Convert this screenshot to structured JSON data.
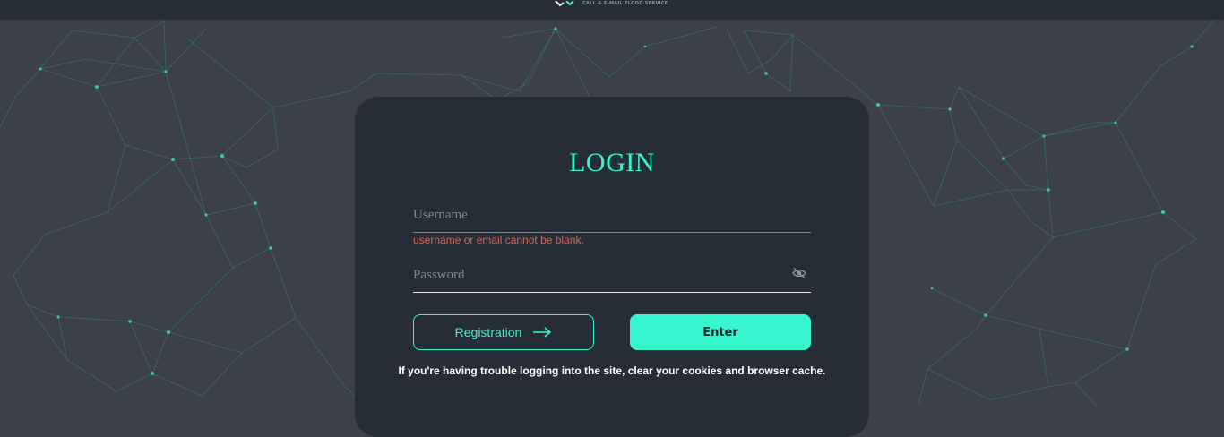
{
  "header": {
    "logo_tagline": "CALL & E-MAIL FLOOD SERVICE"
  },
  "login": {
    "title": "LOGIN",
    "username_placeholder": "Username",
    "username_error": "username or email cannot be blank.",
    "password_placeholder": "Password",
    "password_toggle_icon": "eye-slash-icon",
    "registration_label": "Registration",
    "registration_icon": "arrow-right-icon",
    "enter_label": "Enter",
    "hint": "If you're having trouble logging into the site, clear your cookies and browser cache."
  },
  "colors": {
    "accent": "#37f5cd",
    "card_bg": "#272d36",
    "page_bg": "#3b4049",
    "error": "#d36660"
  }
}
